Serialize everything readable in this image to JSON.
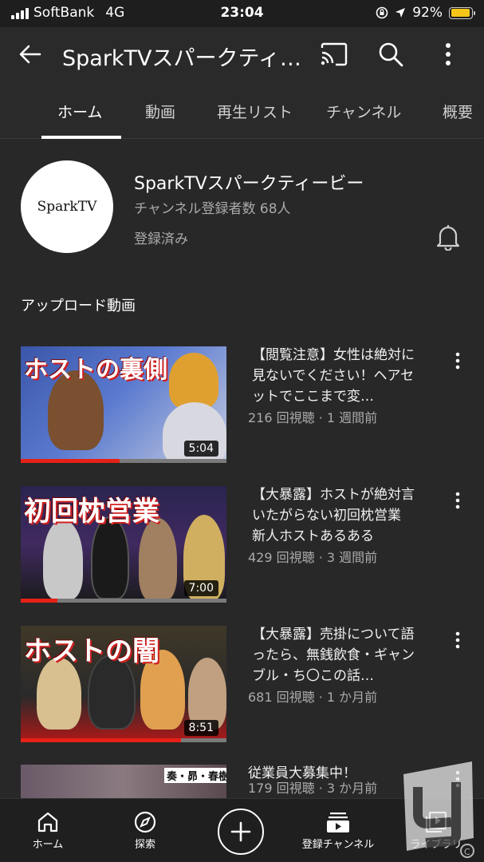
{
  "status_bar": {
    "carrier": "SoftBank",
    "network": "4G",
    "time": "23:04",
    "battery": "92%"
  },
  "header": {
    "title": "SparkTVスパークティー…"
  },
  "tabs": [
    {
      "label": "ホーム",
      "active": true
    },
    {
      "label": "動画"
    },
    {
      "label": "再生リスト"
    },
    {
      "label": "チャンネル"
    },
    {
      "label": "概要"
    }
  ],
  "channel": {
    "avatar_text": "SparkTV",
    "name": "SparkTVスパークティービー",
    "subscribers": "チャンネル登録者数 68人",
    "status": "登録済み"
  },
  "section_title": "アップロード動画",
  "videos": [
    {
      "thumb_text": "ホストの裏側",
      "duration": "5:04",
      "progress": 0.48,
      "title": "【閲覧注意】女性は絶対に見ないでください！ヘアセットでここまで変…",
      "meta": "216 回視聴 · 1 週間前"
    },
    {
      "thumb_text": "初回枕営業",
      "duration": "7:00",
      "progress": 0.18,
      "title": "【大暴露】ホストが絶対言いたがらない初回枕営業　新人ホストあるある",
      "meta": "429 回視聴 · 3 週間前"
    },
    {
      "thumb_text": "ホストの闇",
      "duration": "8:51",
      "progress": 0.78,
      "title": "【大暴露】売掛について語ったら、無銭飲食・ギャンブル・ち〇この話…",
      "meta": "681 回視聴 · 1 か月前"
    },
    {
      "thumb_text": "奏・昴・春樹",
      "duration": "",
      "title": "従業員大募集中！",
      "meta": "179 回視聴 · 3 か月前"
    }
  ],
  "bottom_nav": [
    {
      "label": "ホーム"
    },
    {
      "label": "探索"
    },
    {
      "label": ""
    },
    {
      "label": "登録チャンネル"
    },
    {
      "label": "ライブラリ"
    }
  ],
  "colors": {
    "background": "#282828",
    "header": "#2a2a2a",
    "progress": "#e62117",
    "battery": "#f5c518"
  }
}
